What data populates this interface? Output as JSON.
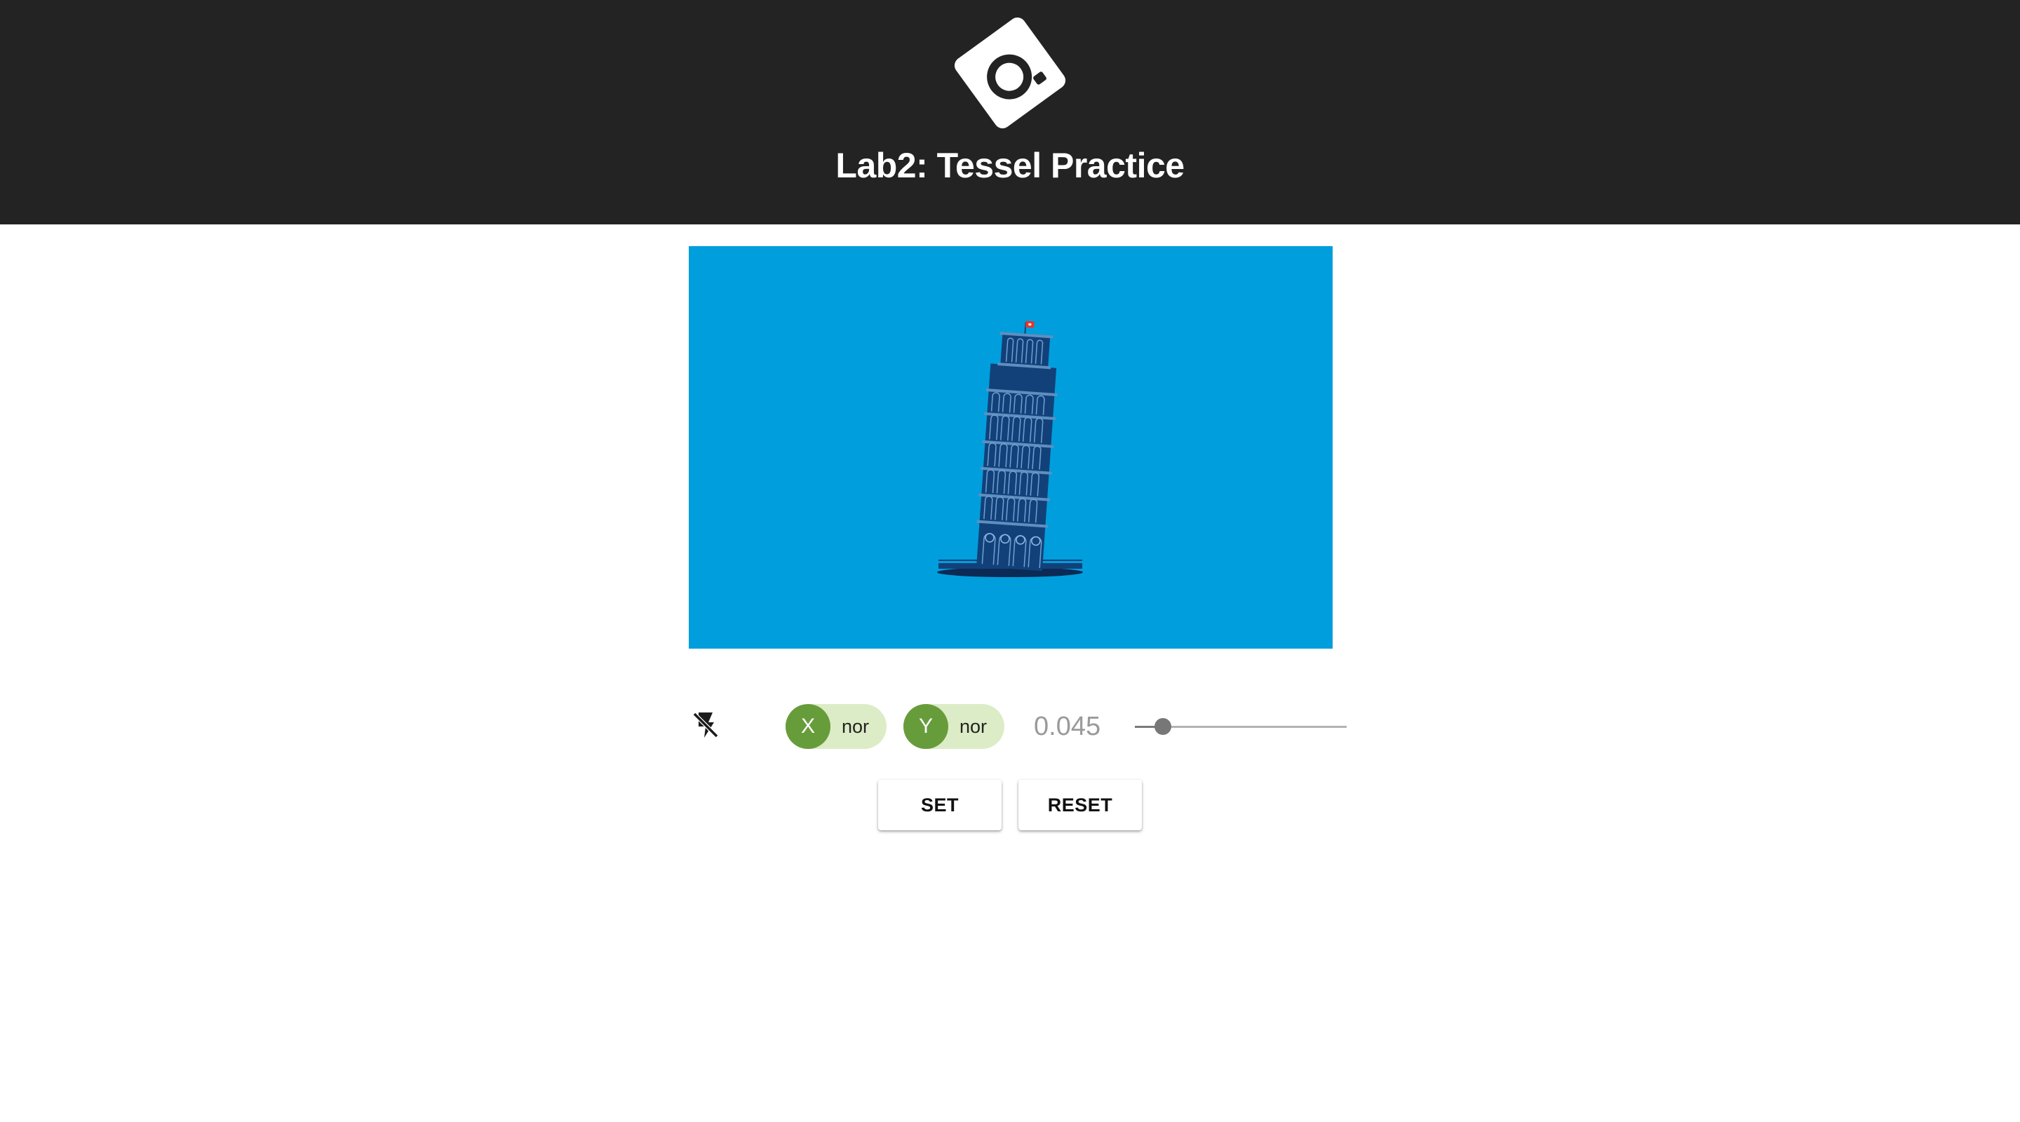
{
  "app": {
    "title": "Lab2: Tessel Practice",
    "logo_icon": "camera-lens-icon"
  },
  "image": {
    "subject": "leaning-tower-of-pisa-illustration",
    "background_color": "#009edc",
    "tower_color": "#12417a",
    "flag_color": "#e8352b"
  },
  "controls": {
    "flash": {
      "icon": "flash-off-icon",
      "enabled": false
    },
    "x_chip": {
      "avatar": "X",
      "label": "nor"
    },
    "y_chip": {
      "avatar": "Y",
      "label": "nor"
    },
    "epsilon": {
      "display": "0.045",
      "value": 0.045,
      "min": 0,
      "max": 1
    },
    "set_label": "SET",
    "reset_label": "RESET"
  },
  "theme": {
    "header_bg": "#232323",
    "chip_bg": "#dcecc6",
    "chip_avatar_bg": "#679c3b"
  }
}
